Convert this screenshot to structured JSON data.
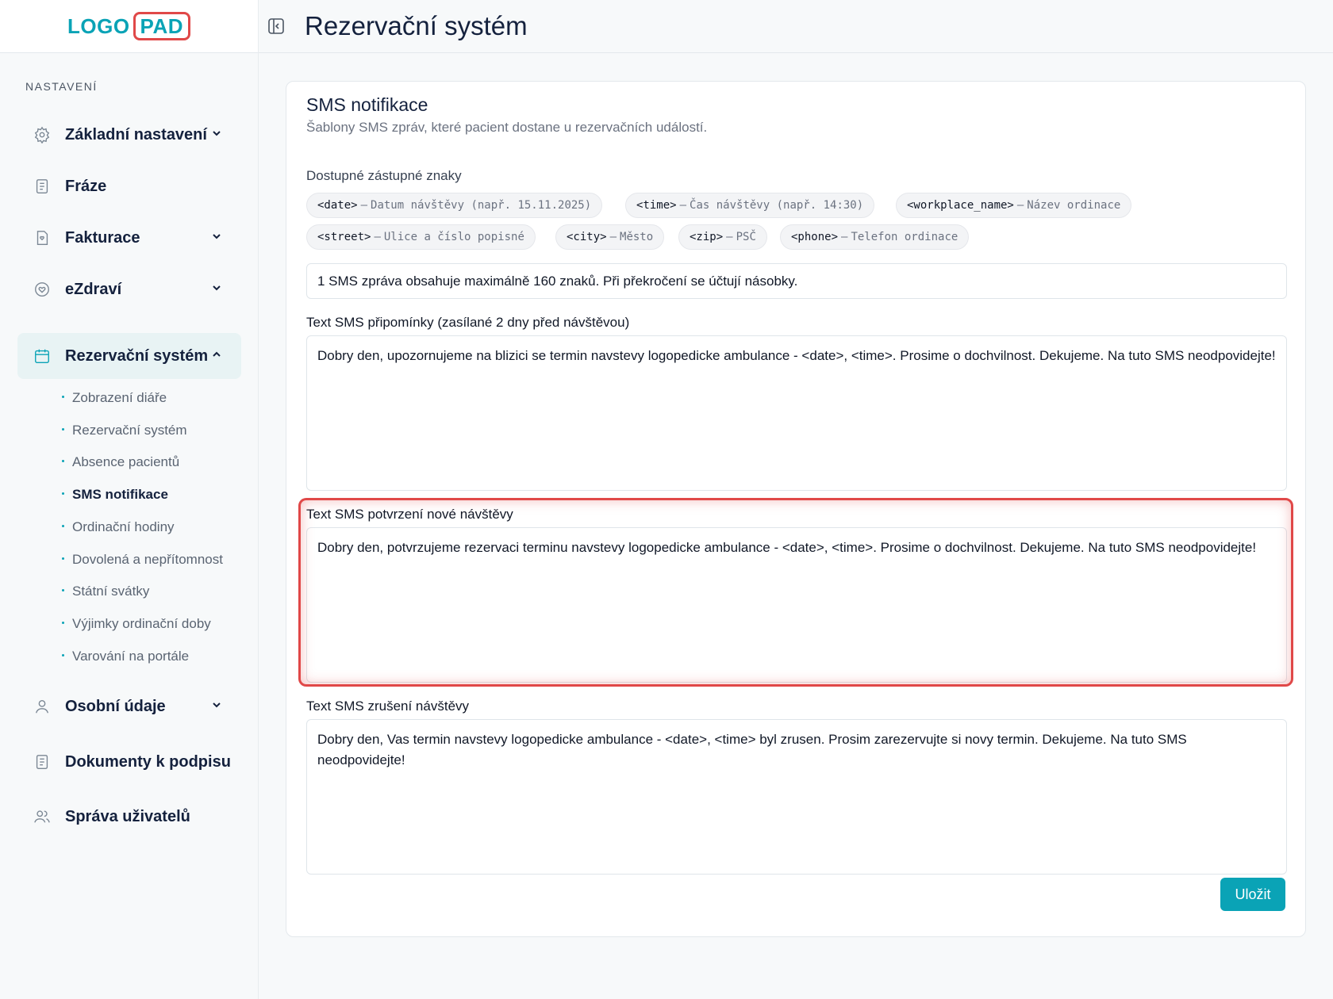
{
  "logo": {
    "logo_text": "LOGO",
    "pad_text": "PAD"
  },
  "header": {
    "title": "Rezervační systém"
  },
  "sidebar": {
    "section": "NASTAVENÍ",
    "items": [
      {
        "label": "Základní nastavení"
      },
      {
        "label": "Fráze"
      },
      {
        "label": "Fakturace"
      },
      {
        "label": "eZdraví"
      },
      {
        "label": "Rezervační systém"
      },
      {
        "label": "Osobní údaje"
      },
      {
        "label": "Dokumenty k podpisu"
      },
      {
        "label": "Správa uživatelů"
      }
    ],
    "subitems": [
      {
        "label": "Zobrazení diáře"
      },
      {
        "label": "Rezervační systém"
      },
      {
        "label": "Absence pacientů"
      },
      {
        "label": "SMS notifikace"
      },
      {
        "label": "Ordinační hodiny"
      },
      {
        "label": "Dovolená a nepřítomnost"
      },
      {
        "label": "Státní svátky"
      },
      {
        "label": "Výjimky ordinační doby"
      },
      {
        "label": "Varování na portále"
      }
    ]
  },
  "card": {
    "title": "SMS notifikace",
    "subtitle": "Šablony SMS zpráv, které pacient dostane u rezervačních událostí.",
    "placeholders_label": "Dostupné zástupné znaky",
    "placeholders": [
      {
        "code": "<date>",
        "desc": "Datum návštěvy (např. 15.11.2025)"
      },
      {
        "code": "<time>",
        "desc": "Čas návštěvy (např. 14:30)"
      },
      {
        "code": "<workplace_name>",
        "desc": "Název ordinace"
      },
      {
        "code": "<street>",
        "desc": "Ulice a číslo popisné"
      },
      {
        "code": "<city>",
        "desc": "Město"
      },
      {
        "code": "<zip>",
        "desc": "PSČ"
      },
      {
        "code": "<phone>",
        "desc": "Telefon ordinace"
      }
    ],
    "separator": "–",
    "info": "1 SMS zpráva obsahuje maximálně 160 znaků. Při překročení se účtují násobky.",
    "fields": [
      {
        "label": "Text SMS připomínky (zasílané 2 dny před návštěvou)",
        "value": "Dobry den, upozornujeme na blizici se termin navstevy logopedicke ambulance - <date>, <time>. Prosime o dochvilnost. Dekujeme. Na tuto SMS neodpovidejte!"
      },
      {
        "label": "Text SMS potvrzení nové návštěvy",
        "value": "Dobry den, potvrzujeme rezervaci terminu navstevy logopedicke ambulance - <date>, <time>. Prosime o dochvilnost. Dekujeme. Na tuto SMS neodpovidejte!"
      },
      {
        "label": "Text SMS zrušení návštěvy",
        "value": "Dobry den, Vas termin navstevy logopedicke ambulance - <date>, <time> byl zrusen. Prosim zarezervujte si novy termin. Dekujeme. Na tuto SMS neodpovidejte!"
      }
    ],
    "save_label": "Uložit"
  },
  "colors": {
    "accent": "#0aa3b6",
    "highlight": "#e04848"
  }
}
